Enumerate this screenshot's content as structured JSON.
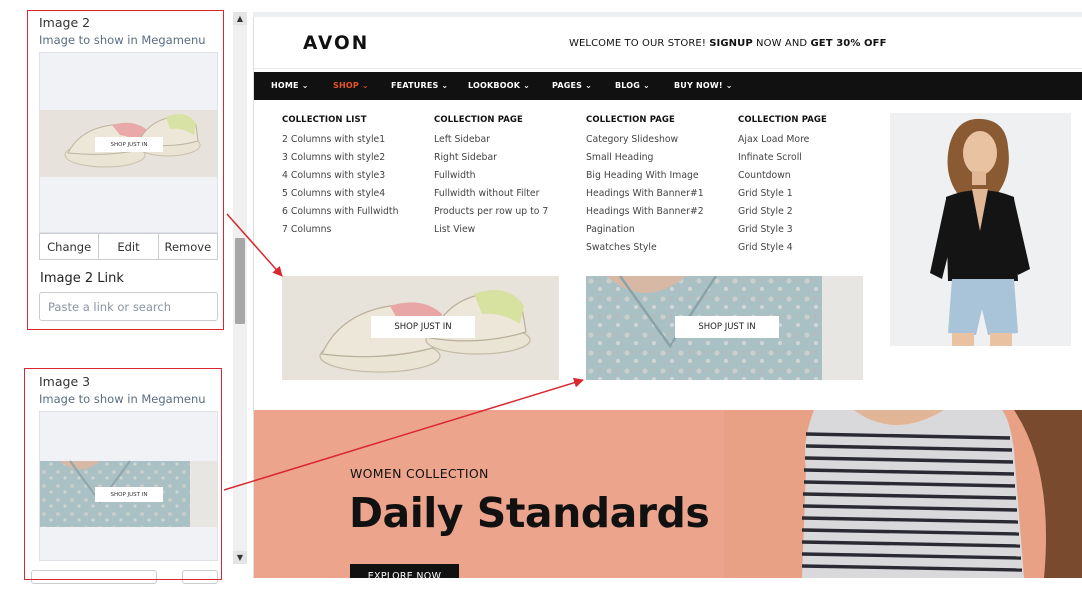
{
  "left_panel": {
    "image2": {
      "label": "Image 2",
      "sublabel": "Image to show in Megamenu",
      "thumb_button": "SHOP JUST IN",
      "actions": [
        "Change",
        "Edit",
        "Remove"
      ],
      "link_label": "Image 2 Link",
      "link_placeholder": "Paste a link or search"
    },
    "image3": {
      "label": "Image 3",
      "sublabel": "Image to show in Megamenu",
      "thumb_button": "SHOP JUST IN"
    }
  },
  "preview": {
    "logo": "AVON",
    "welcome_prefix": "WELCOME TO OUR STORE! ",
    "welcome_signup": "SIGNUP",
    "welcome_mid": " NOW AND ",
    "welcome_offer": "GET 30% OFF",
    "nav": [
      "HOME ⌄",
      "SHOP ⌄",
      "FEATURES ⌄",
      "LOOKBOOK ⌄",
      "PAGES ⌄",
      "BLOG ⌄",
      "BUY NOW! ⌄"
    ],
    "active_nav_color": "#e8532b",
    "menu_columns": [
      {
        "title": "COLLECTION LIST",
        "items": [
          "2 Columns with style1",
          "3 Columns with style2",
          "4 Columns with style3",
          "5 Columns with style4",
          "6 Columns with Fullwidth",
          "7 Columns"
        ]
      },
      {
        "title": "COLLECTION PAGE",
        "items": [
          "Left Sidebar",
          "Right Sidebar",
          "Fullwidth",
          "Fullwidth without Filter",
          "Products per row up to 7",
          "List View"
        ]
      },
      {
        "title": "COLLECTION PAGE",
        "items": [
          "Category Slideshow",
          "Small Heading",
          "Big Heading With Image",
          "Headings With Banner#1",
          "Headings With Banner#2",
          "Pagination",
          "Swatches Style"
        ]
      },
      {
        "title": "COLLECTION PAGE",
        "items": [
          "Ajax Load More",
          "Infinate Scroll",
          "Countdown",
          "Grid Style 1",
          "Grid Style 2",
          "Grid Style 3",
          "Grid Style 4"
        ]
      }
    ],
    "promo_buttons": [
      "SHOP JUST IN",
      "SHOP JUST IN"
    ],
    "hero": {
      "kicker": "WOMEN COLLECTION",
      "title": "Daily Standards",
      "button": "EXPLORE NOW"
    }
  },
  "colors": {
    "highlight_red": "#d9282f",
    "navbar": "#111111",
    "hero_bg": "#eca58c"
  }
}
